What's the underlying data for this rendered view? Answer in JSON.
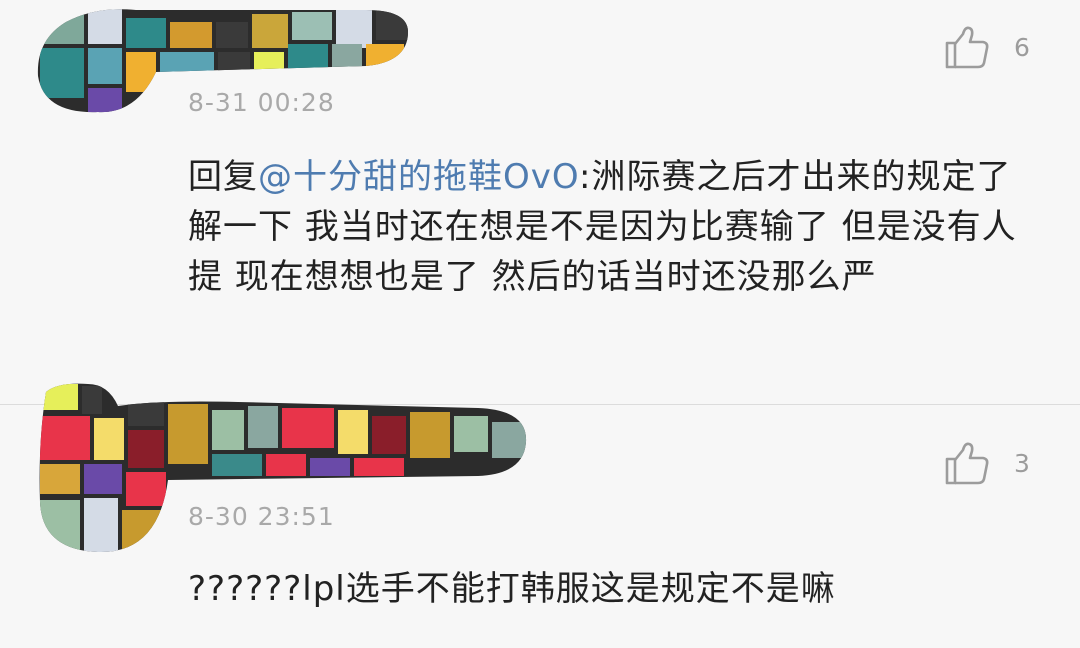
{
  "comments": [
    {
      "time": "8-31  00:28",
      "likes": "6",
      "reply_prefix": "回复",
      "mention": "@十分甜的拖鞋OvO",
      "text": ":洲际赛之后才出来的规定了解一下 我当时还在想是不是因为比赛输了 但是没有人提 现在想想也是了 然后的话当时还没那么严"
    },
    {
      "time": "8-30  23:51",
      "likes": "3",
      "text": "??????lpl选手不能打韩服这是规定不是嘛"
    }
  ],
  "icons": {
    "like": "thumbs-up-icon"
  },
  "colors": {
    "background": "#f7f7f7",
    "mention": "#4f7cb0",
    "meta": "#a9a9a9",
    "text": "#222222"
  }
}
